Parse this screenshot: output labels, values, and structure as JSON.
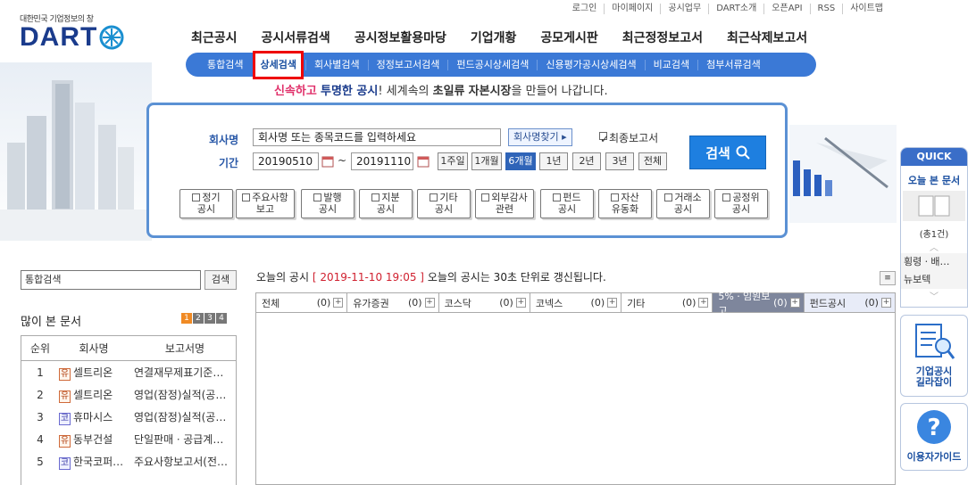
{
  "util": [
    "로그인",
    "마이페이지",
    "공시업무",
    "DART소개",
    "오픈API",
    "RSS",
    "사이트맵"
  ],
  "logo": {
    "tagline": "대한민국 기업정보의 창",
    "word": "DART"
  },
  "gnb": [
    "최근공시",
    "공시서류검색",
    "공시정보활용마당",
    "기업개황",
    "공모게시판",
    "최근정정보고서",
    "최근삭제보고서"
  ],
  "lnb": [
    "통합검색",
    "상세검색",
    "회사별검색",
    "정정보고서검색",
    "펀드공시상세검색",
    "신용평가공시상세검색",
    "비교검색",
    "첨부서류검색"
  ],
  "slogan": {
    "p1": "신속하고",
    "p2": "투명한 공시",
    "p3": "! 세계속의",
    "p4": "초일류",
    "p5": "자본시장",
    "p6": "을 만들어 나갑니다."
  },
  "search": {
    "company_label": "회사명",
    "company_placeholder": "회사명 또는 종목코드를 입력하세요",
    "find_button": "회사명찾기",
    "final_report": "최종보고서",
    "period_label": "기간",
    "start_date": "20190510",
    "end_date": "20191110",
    "tilde": "~",
    "periods": [
      "1주일",
      "1개월",
      "6개월",
      "1년",
      "2년",
      "3년",
      "전체"
    ],
    "selected_period": "6개월",
    "search_button": "검색",
    "categories": [
      [
        "정기",
        "공시"
      ],
      [
        "주요사항",
        "보고"
      ],
      [
        "발행",
        "공시"
      ],
      [
        "지분",
        "공시"
      ],
      [
        "기타",
        "공시"
      ],
      [
        "외부감사",
        "관련"
      ],
      [
        "펀드",
        "공시"
      ],
      [
        "자산",
        "유동화"
      ],
      [
        "거래소",
        "공시"
      ],
      [
        "공정위",
        "공시"
      ]
    ]
  },
  "quick": {
    "head": "QUICK",
    "today": "오늘 본 문서",
    "count": "(총1건)",
    "item1": "횡령ㆍ배…",
    "item2": "뉴보텍",
    "guide_title1": "기업공시",
    "guide_title2": "길라잡이",
    "help": "이용자가이드"
  },
  "left": {
    "search_value": "통합검색",
    "search_button": "검색",
    "many_title": "많이 본 문서",
    "pages": [
      "1",
      "2",
      "3",
      "4"
    ],
    "headers": [
      "순위",
      "회사명",
      "보고서명"
    ],
    "rows": [
      {
        "rank": "1",
        "mark": "유",
        "company": "셀트리온",
        "report": "연결재무제표기준…"
      },
      {
        "rank": "2",
        "mark": "유",
        "company": "셀트리온",
        "report": "영업(잠정)실적(공…"
      },
      {
        "rank": "3",
        "mark": "코",
        "company": "휴마시스",
        "report": "영업(잠정)실적(공…"
      },
      {
        "rank": "4",
        "mark": "유",
        "company": "동부건설",
        "report": "단일판매ㆍ공급계…"
      },
      {
        "rank": "5",
        "mark": "코",
        "company": "한국코퍼…",
        "report": "주요사항보고서(전…"
      }
    ]
  },
  "today": {
    "label": "오늘의 공시",
    "datetime": "[ 2019-11-10 19:05 ]",
    "notice": "오늘의 공시는 30초 단위로 갱신됩니다.",
    "tabs": [
      {
        "name": "전체",
        "count": "(0)"
      },
      {
        "name": "유가증권",
        "count": "(0)"
      },
      {
        "name": "코스닥",
        "count": "(0)"
      },
      {
        "name": "코넥스",
        "count": "(0)"
      },
      {
        "name": "기타",
        "count": "(0)"
      },
      {
        "name": "5%ㆍ임원보고",
        "count": "(0)"
      },
      {
        "name": "펀드공시",
        "count": "(0)"
      }
    ]
  },
  "colors": {
    "brand": "#1a3b8c",
    "accent": "#3b79d6",
    "highlight": "#e00000"
  }
}
